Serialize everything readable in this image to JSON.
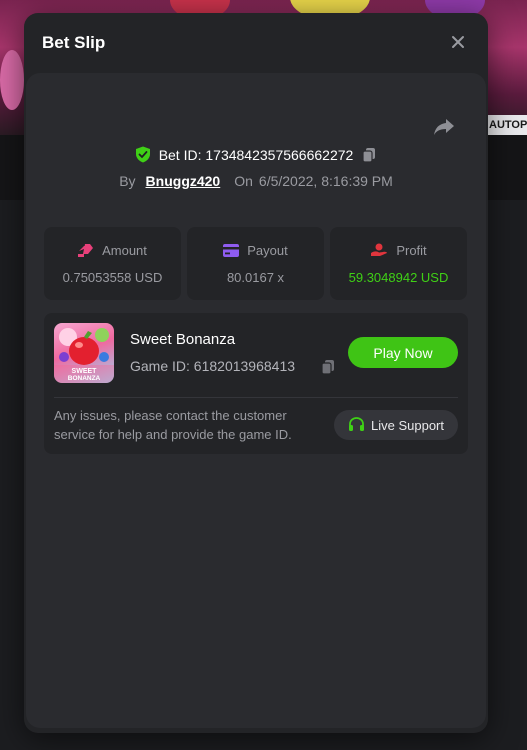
{
  "background": {
    "autoplay_label": "AUTOPLAY"
  },
  "modal": {
    "title": "Bet Slip",
    "bet_id_label": "Bet ID: 1734842357566662272",
    "by_label": "By",
    "username": "Bnuggz420",
    "on_label": "On",
    "timestamp": "6/5/2022, 8:16:39 PM"
  },
  "stats": {
    "amount": {
      "label": "Amount",
      "value": "0.75053558 USD"
    },
    "payout": {
      "label": "Payout",
      "value": "80.0167 x"
    },
    "profit": {
      "label": "Profit",
      "value": "59.3048942 USD"
    }
  },
  "game": {
    "name": "Sweet Bonanza",
    "game_id": "Game ID: 6182013968413",
    "thumb_text": "SWEET BONANZA",
    "play_label": "Play Now",
    "support_text": "Any issues, please contact the customer service for help and provide the game ID.",
    "support_label": "Live Support"
  },
  "colors": {
    "profit_green": "#3fd016",
    "play_green": "#3fc415",
    "amount_pink": "#e8407a",
    "payout_purple": "#8f5cf0",
    "profit_red": "#e0353d"
  }
}
